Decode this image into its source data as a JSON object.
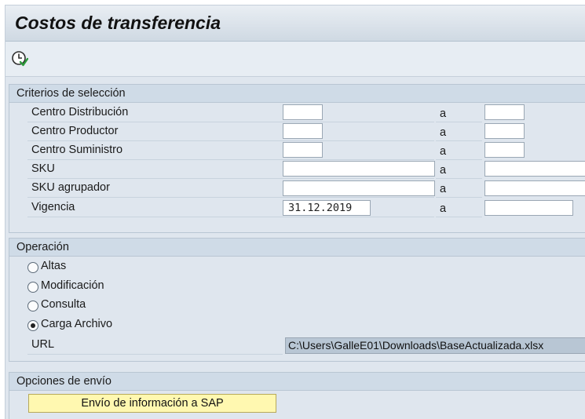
{
  "title": "Costos de transferencia",
  "toolbar": {
    "execute_icon": "execute-clock-icon"
  },
  "criteria": {
    "header": "Criterios de selección",
    "range_label": "a",
    "rows": [
      {
        "label": "Centro Distribución",
        "from": "",
        "to": ""
      },
      {
        "label": "Centro Productor",
        "from": "",
        "to": ""
      },
      {
        "label": "Centro Suministro",
        "from": "",
        "to": ""
      },
      {
        "label": "SKU",
        "from": "",
        "to": ""
      },
      {
        "label": "SKU agrupador",
        "from": "",
        "to": ""
      },
      {
        "label": "Vigencia",
        "from": "31.12.2019",
        "to": ""
      }
    ]
  },
  "operation": {
    "header": "Operación",
    "options": [
      {
        "label": "Altas",
        "selected": false
      },
      {
        "label": "Modificación",
        "selected": false
      },
      {
        "label": "Consulta",
        "selected": false
      },
      {
        "label": "Carga Archivo",
        "selected": true
      }
    ],
    "url_label": "URL",
    "url_value": "C:\\Users\\GalleE01\\Downloads\\BaseActualizada.xlsx"
  },
  "send": {
    "header": "Opciones de envío",
    "button_label": "Envío de información a SAP"
  }
}
